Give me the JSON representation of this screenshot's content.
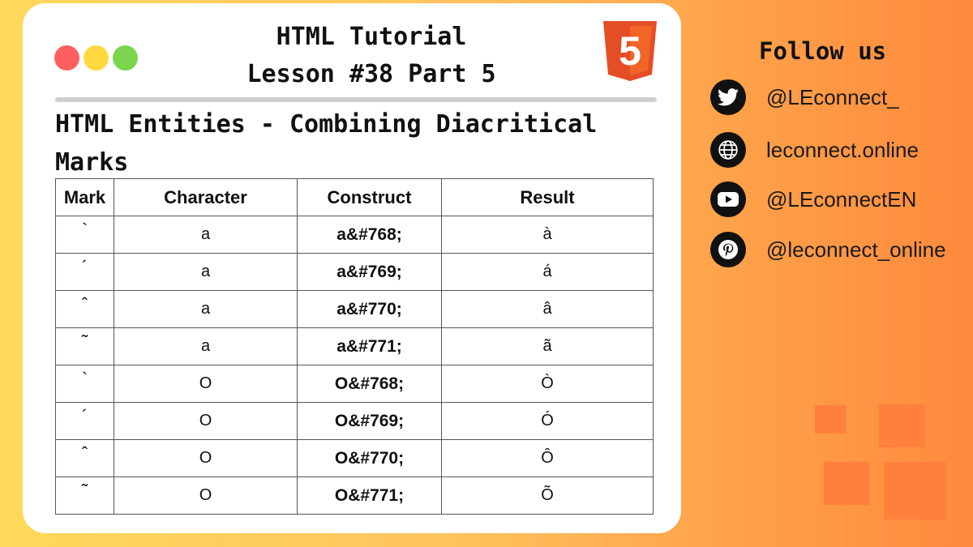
{
  "header": {
    "title_line1": "HTML Tutorial",
    "title_line2": "Lesson #38 Part 5",
    "logo_text": "5"
  },
  "subtitle": "HTML Entities - Combining Diacritical Marks",
  "table": {
    "headers": [
      "Mark",
      "Character",
      "Construct",
      "Result"
    ],
    "rows": [
      {
        "mark": "`",
        "character": "a",
        "construct": "a&#768;",
        "result": "à"
      },
      {
        "mark": "´",
        "character": "a",
        "construct": "a&#769;",
        "result": "á"
      },
      {
        "mark": "ˆ",
        "character": "a",
        "construct": "a&#770;",
        "result": "â"
      },
      {
        "mark": "˜",
        "character": "a",
        "construct": "a&#771;",
        "result": "ã"
      },
      {
        "mark": "`",
        "character": "O",
        "construct": "O&#768;",
        "result": "Ò"
      },
      {
        "mark": "´",
        "character": "O",
        "construct": "O&#769;",
        "result": "Ó"
      },
      {
        "mark": "ˆ",
        "character": "O",
        "construct": "O&#770;",
        "result": "Ô"
      },
      {
        "mark": "˜",
        "character": "O",
        "construct": "O&#771;",
        "result": "Õ"
      }
    ]
  },
  "follow": {
    "title": "Follow us",
    "links": [
      {
        "icon": "twitter-icon",
        "label": "@LEconnect_"
      },
      {
        "icon": "globe-icon",
        "label": "leconnect.online"
      },
      {
        "icon": "youtube-icon",
        "label": "@LEconnectEN"
      },
      {
        "icon": "pinterest-icon",
        "label": "@leconnect_online"
      }
    ]
  },
  "colors": {
    "accent_orange": "#ff7f3c",
    "html5_orange": "#e44d26",
    "dot_red": "#ff5f5f",
    "dot_yellow": "#ffd93f",
    "dot_green": "#7cd44f"
  }
}
